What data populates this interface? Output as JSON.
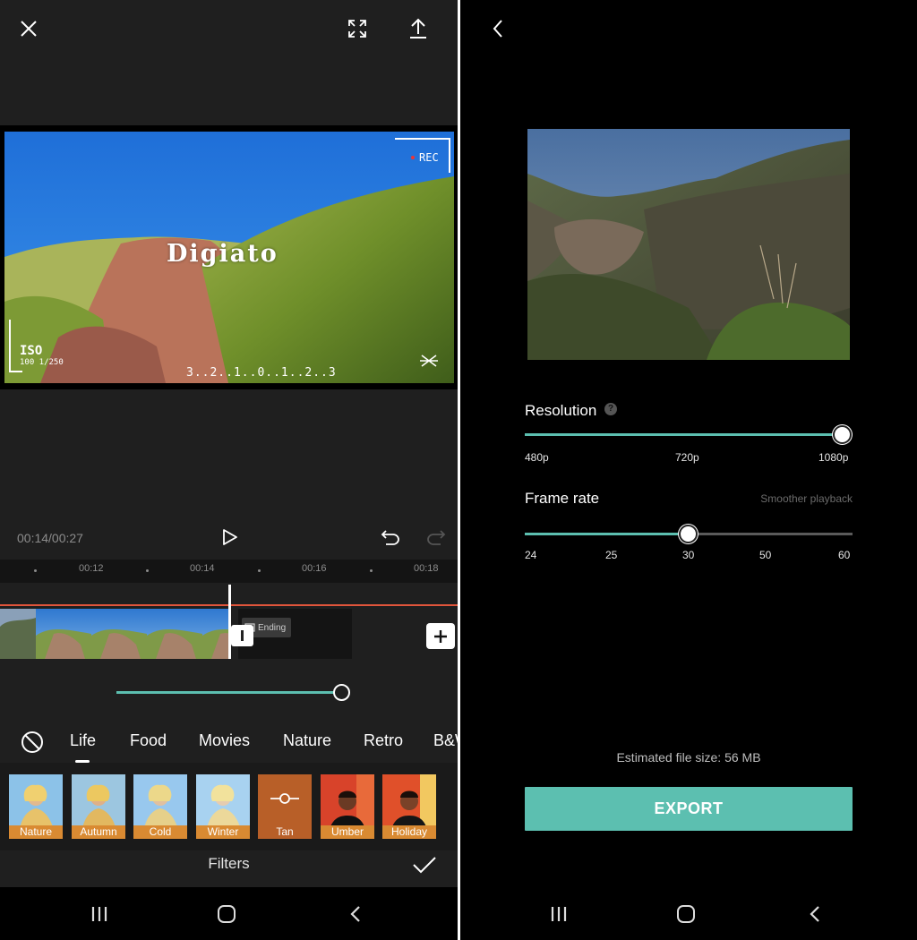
{
  "editor": {
    "preview_overlay": {
      "title_text": "Digiato",
      "rec_label": "REC",
      "iso_label": "ISO",
      "iso_sub": "100 1/250",
      "counter": "3..2..1..0..1..2..3"
    },
    "timecode": "00:14/00:27",
    "ruler_labels": [
      "00:12",
      "00:14",
      "00:16",
      "00:18"
    ],
    "ending_label": "Ending",
    "filter_intensity": 1.0,
    "categories": [
      "Life",
      "Food",
      "Movies",
      "Nature",
      "Retro",
      "B&W"
    ],
    "selected_category": "Life",
    "filters": [
      {
        "label": "Nature"
      },
      {
        "label": "Autumn"
      },
      {
        "label": "Cold"
      },
      {
        "label": "Winter"
      },
      {
        "label": "Tan",
        "selected": true
      },
      {
        "label": "Umber"
      },
      {
        "label": "Holiday"
      }
    ],
    "panel_title": "Filters"
  },
  "export": {
    "resolution": {
      "label": "Resolution",
      "options": [
        "480p",
        "720p",
        "1080p"
      ],
      "selected": "1080p"
    },
    "frame_rate": {
      "label": "Frame rate",
      "hint": "Smoother playback",
      "options": [
        "24",
        "25",
        "30",
        "50",
        "60"
      ],
      "selected": "30"
    },
    "file_size": "Estimated file size: 56 MB",
    "button_label": "EXPORT"
  },
  "colors": {
    "accent": "#5cbfb0",
    "playhead_line": "#e0553b",
    "filter_label": "#d98a32"
  }
}
